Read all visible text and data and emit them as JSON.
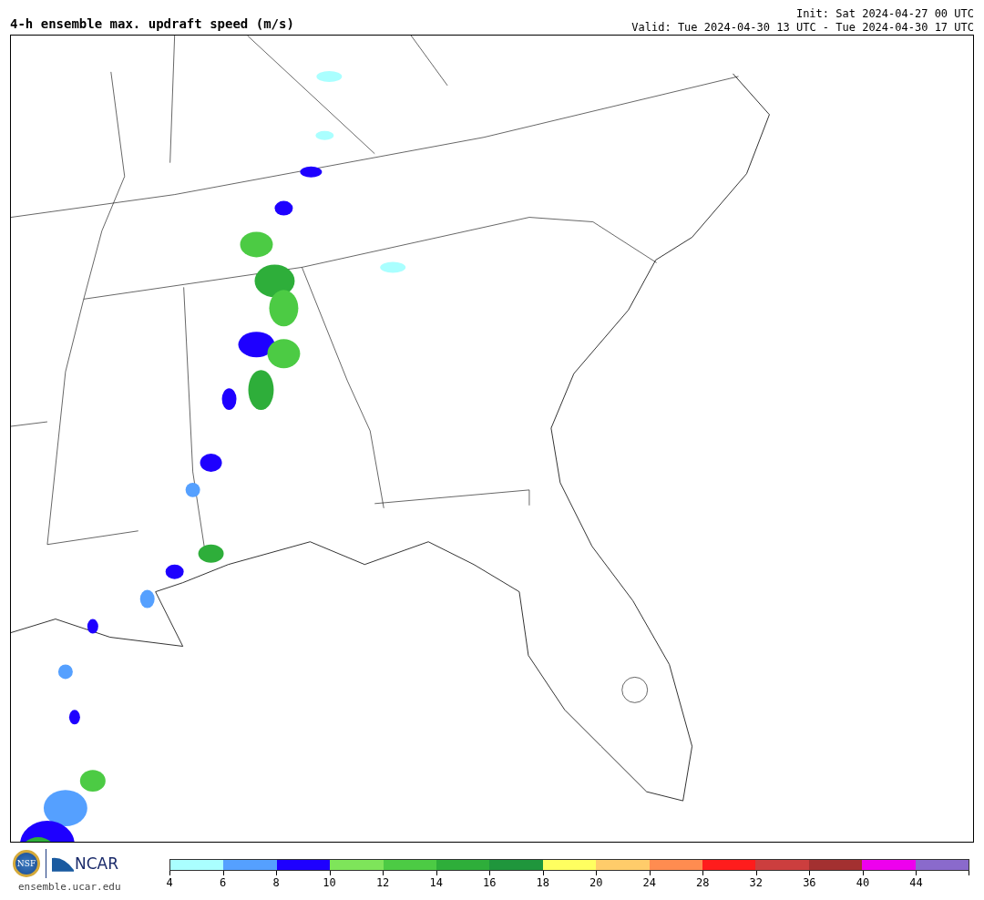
{
  "title": "4-h ensemble max. updraft speed (m/s)",
  "init": "Init: Sat 2024-04-27 00 UTC",
  "valid": "Valid: Tue 2024-04-30 13 UTC - Tue 2024-04-30 17 UTC",
  "logos": {
    "nsf": "NSF",
    "ncar": "NCAR",
    "url": "ensemble.ucar.edu"
  },
  "colorbar": [
    {
      "color": "#aaffff",
      "label": "4"
    },
    {
      "color": "#55a0ff",
      "label": "6"
    },
    {
      "color": "#1e00ff",
      "label": "8"
    },
    {
      "color": "#7ee55a",
      "label": "10"
    },
    {
      "color": "#4ccb44",
      "label": "12"
    },
    {
      "color": "#2eae3a",
      "label": "14"
    },
    {
      "color": "#1f963c",
      "label": "16"
    },
    {
      "color": "#ffff60",
      "label": "18"
    },
    {
      "color": "#ffcc6a",
      "label": "20"
    },
    {
      "color": "#ff8c50",
      "label": "24"
    },
    {
      "color": "#ff1c1c",
      "label": "28"
    },
    {
      "color": "#cc3e3e",
      "label": "32"
    },
    {
      "color": "#a33030",
      "label": "36"
    },
    {
      "color": "#ee00ee",
      "label": "40"
    },
    {
      "color": "#8a6acc",
      "label": "44"
    }
  ]
}
